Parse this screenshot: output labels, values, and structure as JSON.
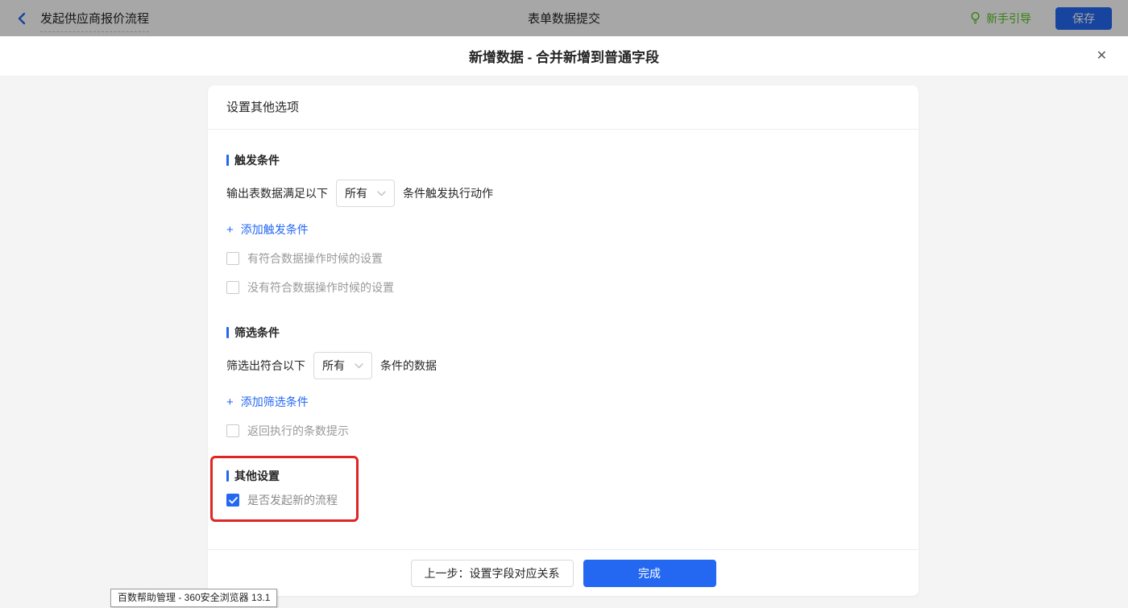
{
  "topbar": {
    "back_label": "发起供应商报价流程",
    "center_title": "表单数据提交",
    "guide_label": "新手引导",
    "save_label": "保存"
  },
  "modal": {
    "title": "新增数据 - 合并新增到普通字段"
  },
  "card": {
    "header": "设置其他选项",
    "trigger_section": {
      "title": "触发条件",
      "row_prefix": "输出表数据满足以下",
      "select_value": "所有",
      "row_suffix": "条件触发执行动作",
      "add_link": "添加触发条件",
      "checkbox_has_match": "有符合数据操作时候的设置",
      "checkbox_no_match": "没有符合数据操作时候的设置"
    },
    "filter_section": {
      "title": "筛选条件",
      "row_prefix": "筛选出符合以下",
      "select_value": "所有",
      "row_suffix": "条件的数据",
      "add_link": "添加筛选条件",
      "checkbox_count_tip": "返回执行的条数提示"
    },
    "other_section": {
      "title": "其他设置",
      "checkbox_new_flow": "是否发起新的流程",
      "checkbox_new_flow_checked": true
    },
    "footer": {
      "prev_label": "上一步：设置字段对应关系",
      "done_label": "完成"
    }
  },
  "statusbar": {
    "tooltip": "百数帮助管理 - 360安全浏览器 13.1"
  },
  "icons": {
    "plus": "+",
    "close": "✕"
  },
  "colors": {
    "accent_blue": "#2468f2",
    "guide_green": "#52c41a",
    "annotation_red": "#e12424",
    "topbar_dim": "rgba(0,0,0,0.345)",
    "body_gray": "#f4f4f5"
  }
}
